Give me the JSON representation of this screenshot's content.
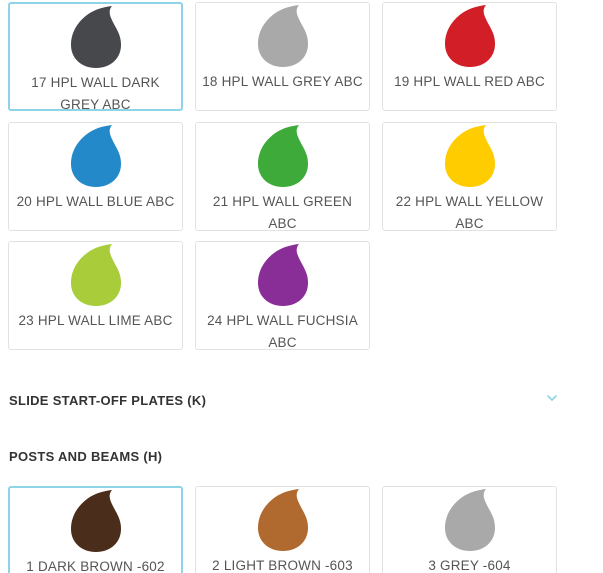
{
  "colors": {
    "dark_grey": "#46484c",
    "grey": "#a9a9aa",
    "red": "#d21f27",
    "blue": "#2389c8",
    "green": "#3eaa3a",
    "yellow": "#ffcc00",
    "lime": "#a8cc3a",
    "fuchsia": "#8a2e97",
    "dark_brown": "#4b2d1b",
    "light_brown": "#b06a30",
    "grey_post": "#a9a9aa",
    "selected_border": "#8fd3e6",
    "chevron": "#8fd3e6"
  },
  "wall_colors": [
    {
      "label": "17 HPL WALL DARK GREY ABC",
      "color_key": "dark_grey",
      "selected": true
    },
    {
      "label": "18 HPL WALL GREY ABC",
      "color_key": "grey",
      "selected": false
    },
    {
      "label": "19 HPL WALL RED ABC",
      "color_key": "red",
      "selected": false
    },
    {
      "label": "20 HPL WALL BLUE ABC",
      "color_key": "blue",
      "selected": false
    },
    {
      "label": "21 HPL WALL GREEN ABC",
      "color_key": "green",
      "selected": false
    },
    {
      "label": "22 HPL WALL YELLOW ABC",
      "color_key": "yellow",
      "selected": false
    },
    {
      "label": "23 HPL WALL LIME ABC",
      "color_key": "lime",
      "selected": false
    },
    {
      "label": "24 HPL WALL FUCHSIA ABC",
      "color_key": "fuchsia",
      "selected": false
    }
  ],
  "sections": {
    "slide_start_off": {
      "title": "SLIDE START-OFF PLATES (K)",
      "icon": "chevron-down-icon",
      "expanded": false
    },
    "posts_and_beams": {
      "title": "POSTS AND BEAMS (H)"
    }
  },
  "post_colors": [
    {
      "label": "1 DARK BROWN -602",
      "color_key": "dark_brown",
      "selected": true
    },
    {
      "label": "2 LIGHT BROWN -603",
      "color_key": "light_brown",
      "selected": false
    },
    {
      "label": "3 GREY -604",
      "color_key": "grey_post",
      "selected": false
    }
  ]
}
